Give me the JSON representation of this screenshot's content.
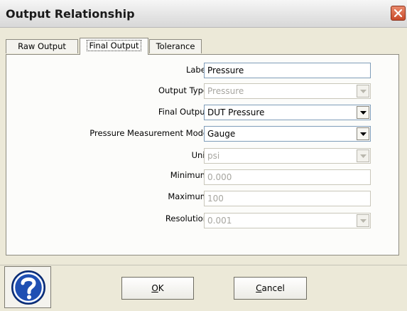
{
  "window": {
    "title": "Output Relationship"
  },
  "tabs": [
    {
      "label": "Raw Output"
    },
    {
      "label": "Final Output"
    },
    {
      "label": "Tolerance"
    }
  ],
  "active_tab": "Final Output",
  "form": {
    "label": {
      "label": "Label",
      "value": "Pressure"
    },
    "output_type": {
      "label": "Output Type",
      "value": "Pressure"
    },
    "final_output": {
      "label": "Final Output",
      "value": "DUT Pressure"
    },
    "pressure_mode": {
      "label": "Pressure Measurement Mode",
      "value": "Gauge"
    },
    "unit": {
      "label": "Unit",
      "value": "psi"
    },
    "minimum": {
      "label": "Minimum",
      "value": "0.000"
    },
    "maximum": {
      "label": "Maximum",
      "value": "100"
    },
    "resolution": {
      "label": "Resolution",
      "value": "0.001"
    }
  },
  "buttons": {
    "ok_underlined": "O",
    "ok_rest": "K",
    "cancel_underlined": "C",
    "cancel_rest": "ancel"
  },
  "icons": {
    "close": "close-icon",
    "help": "question-icon",
    "dropdown": "chevron-down-icon"
  },
  "colors": {
    "close_button": "#c94a2a",
    "help_icon": "#1f4fb3",
    "field_border": "#7f9db9",
    "disabled_text": "#a7a6a0"
  }
}
